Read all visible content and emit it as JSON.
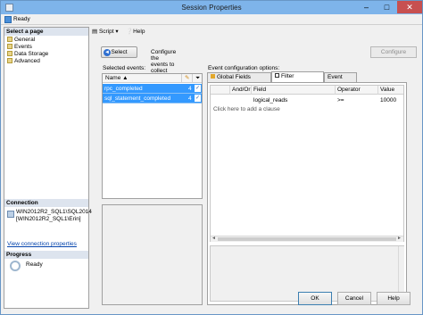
{
  "window": {
    "title": "Session Properties",
    "minimize": "–",
    "maximize": "□",
    "close": "✕"
  },
  "status": {
    "text": "Ready"
  },
  "left_pane": {
    "select_page_header": "Select a page",
    "pages": [
      "General",
      "Events",
      "Data Storage",
      "Advanced"
    ],
    "connection_header": "Connection",
    "connection_lines": [
      "WIN2012R2_SQL1\\SQL2014",
      "[WIN2012R2_SQL1\\Erin]"
    ],
    "view_connection_link": "View connection properties",
    "progress_header": "Progress",
    "progress_text": "Ready"
  },
  "toolbar": {
    "script_label": "Script",
    "script_arrow": "▾",
    "help_label": "Help"
  },
  "events_page": {
    "select_button": "Select",
    "instructions": "Configure the events to collect additional fields and specify filters.",
    "configure_button": "Configure",
    "selected_events_label": "Selected events:",
    "columns": {
      "name": "Name",
      "sort_indicator": "▲"
    },
    "events": [
      {
        "name": "rpc_completed",
        "count": "4",
        "check": "✓"
      },
      {
        "name": "sql_statement_completed",
        "count": "4",
        "check": "✓"
      }
    ]
  },
  "config": {
    "label": "Event configuration options:",
    "tabs": [
      "Global Fields (Actions)",
      "Filter (Predicate)",
      "Event Fields"
    ],
    "active_tab": "Filter (Predicate)",
    "grid_headers": [
      "And/Or",
      "Field",
      "Operator",
      "Value"
    ],
    "rows": [
      {
        "and_or": "",
        "field": "logical_reads",
        "operator": ">=",
        "value": "10000"
      }
    ],
    "add_clause_hint": "Click here to add a clause",
    "scroll_left": "◄",
    "scroll_right": "►"
  },
  "buttons": {
    "ok": "OK",
    "cancel": "Cancel",
    "help": "Help"
  },
  "colors": {
    "title_bar": "#7eb4ea",
    "selection": "#3399ff",
    "close": "#c75050",
    "link": "#0645ad"
  }
}
